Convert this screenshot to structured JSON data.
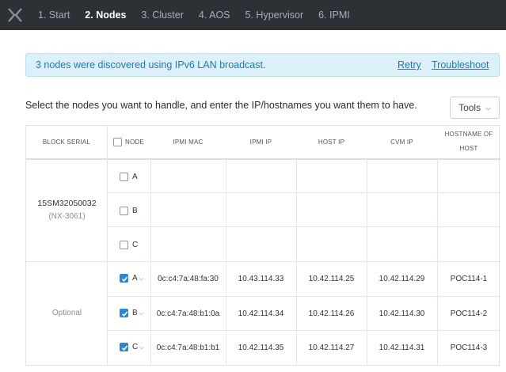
{
  "colors": {
    "topbar": "#2d3034",
    "accent": "#2b86d6",
    "banner_bg": "#dcf0f9",
    "banner_text": "#1d7ab5"
  },
  "nav": {
    "logo_icon": "nutanix-x-logo",
    "steps": [
      "1. Start",
      "2. Nodes",
      "3. Cluster",
      "4. AOS",
      "5. Hypervisor",
      "6. IPMI"
    ],
    "active_step": "2. Nodes"
  },
  "banner": {
    "message": "3 nodes were discovered using IPv6 LAN broadcast.",
    "retry": "Retry",
    "troubleshoot": "Troubleshoot"
  },
  "instructions": "Select the nodes you want to handle, and enter the IP/hostnames you want them to have.",
  "tools": {
    "label": "Tools",
    "icon": "chevron-down-icon"
  },
  "table": {
    "headers": {
      "block_serial": "BLOCK SERIAL",
      "node": "NODE",
      "ipmi_mac": "IPMI MAC",
      "ipmi_ip": "IPMI IP",
      "host_ip": "HOST IP",
      "cvm_ip": "CVM IP",
      "hostname_line1": "HOSTNAME OF",
      "hostname_line2": "HOST"
    },
    "block1": {
      "serial": "15SM32050032",
      "model": "(NX-3061)",
      "nodes": [
        {
          "letter": "A",
          "checked": false
        },
        {
          "letter": "B",
          "checked": false
        },
        {
          "letter": "C",
          "checked": false
        }
      ]
    },
    "block2": {
      "label": "Optional",
      "nodes": [
        {
          "letter": "A",
          "checked": true,
          "ipmi_mac": "0c:c4:7a:48:fa:30",
          "ipmi_ip": "10.43.114.33",
          "host_ip": "10.42.114.25",
          "cvm_ip": "10.42.114.29",
          "hostname": "POC114-1"
        },
        {
          "letter": "B",
          "checked": true,
          "ipmi_mac": "0c:c4:7a:48:b1:0a",
          "ipmi_ip": "10.42.114.34",
          "host_ip": "10.42.114.26",
          "cvm_ip": "10.42.114.30",
          "hostname": "POC114-2"
        },
        {
          "letter": "C",
          "checked": true,
          "ipmi_mac": "0c:c4:7a:48:b1:b1",
          "ipmi_ip": "10.42.114.35",
          "host_ip": "10.42.114.27",
          "cvm_ip": "10.42.114.31",
          "hostname": "POC114-3"
        }
      ]
    }
  }
}
